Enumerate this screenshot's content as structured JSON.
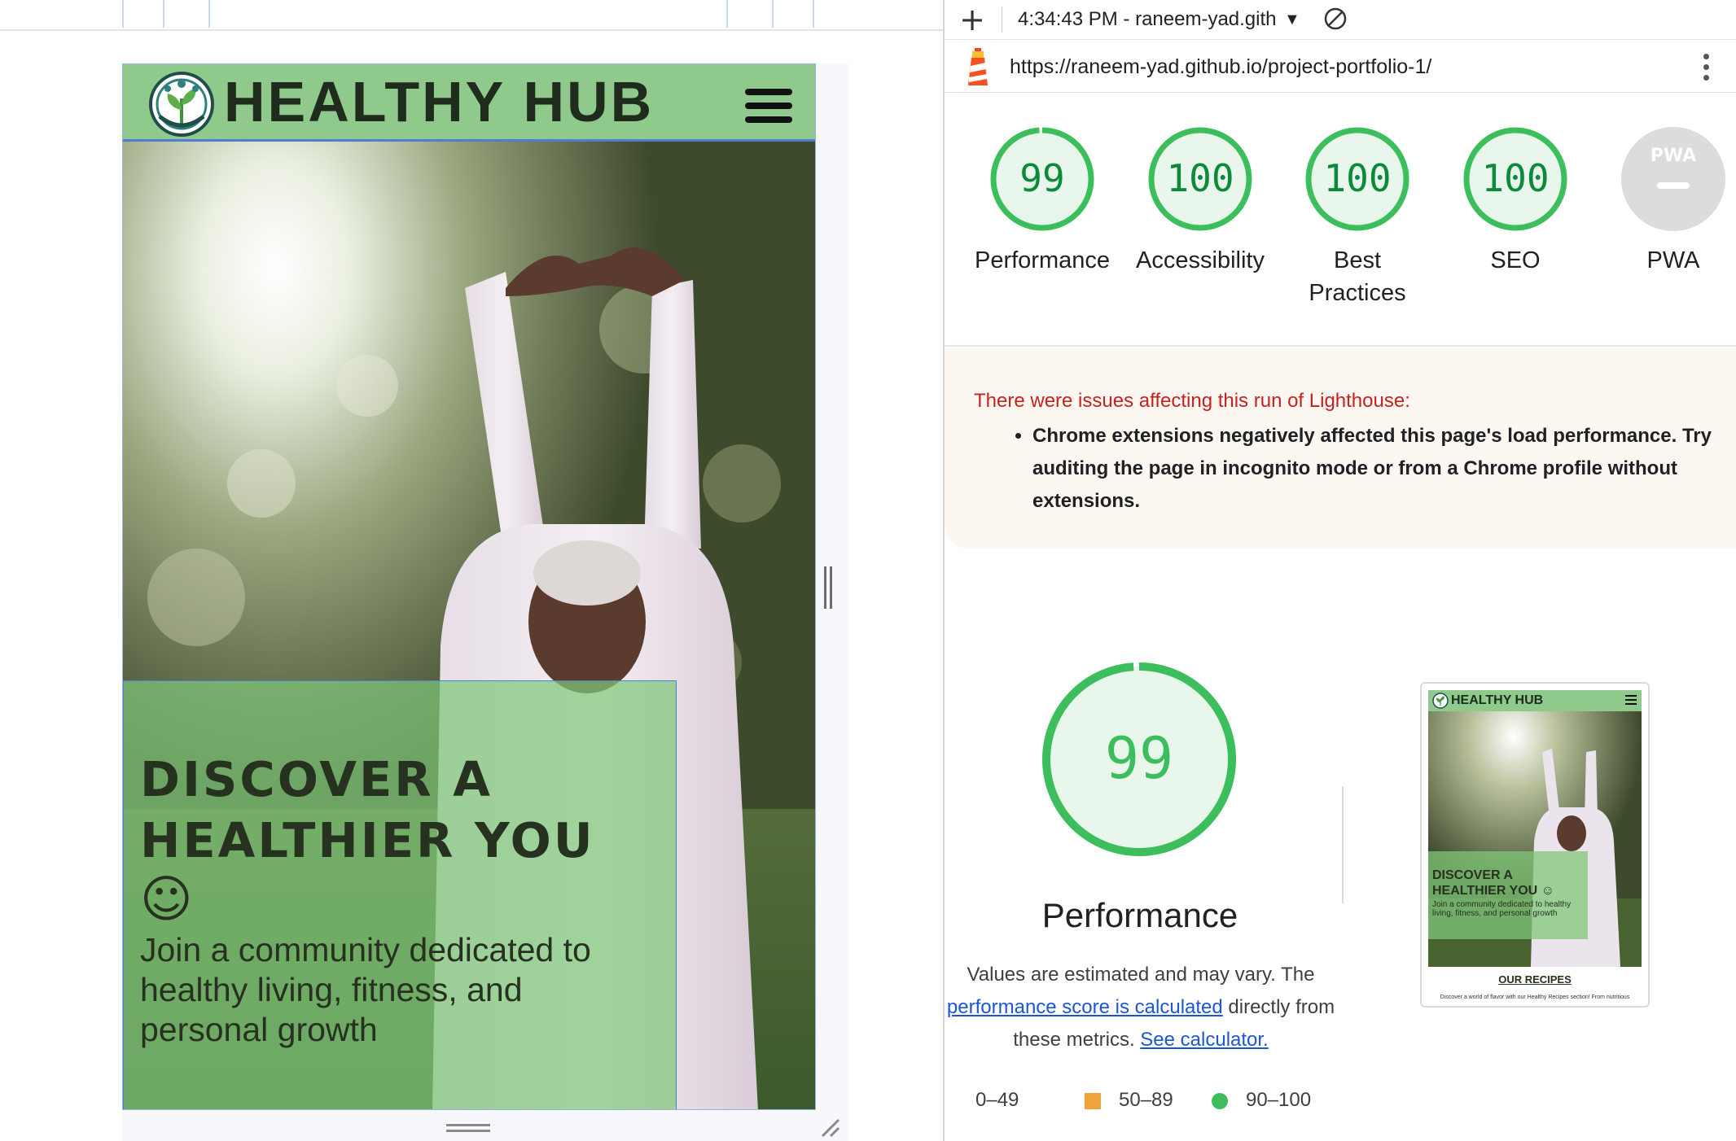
{
  "preview": {
    "site": {
      "title": "HEALTHY HUB",
      "hero_heading": "DISCOVER A HEALTHIER YOU",
      "hero_smiley": "☺",
      "hero_text": "Join a community dedicated to healthy living, fitness, and personal growth",
      "header_color": "#8fc98c",
      "hero_box_color": "#80c87a"
    }
  },
  "panel": {
    "toolbar": {
      "new_report_icon": "plus-icon",
      "report_label": "4:34:43 PM - raneem-yad.gith",
      "clear_icon": "block-icon"
    },
    "url": "https://raneem-yad.github.io/project-portfolio-1/",
    "categories": [
      {
        "label": "Performance",
        "score": "99",
        "percent": 99
      },
      {
        "label": "Accessibility",
        "score": "100",
        "percent": 100
      },
      {
        "label": "Best Practices",
        "score": "100",
        "percent": 100
      },
      {
        "label": "SEO",
        "score": "100",
        "percent": 100
      },
      {
        "label": "PWA",
        "badge": "PWA"
      }
    ],
    "warning": {
      "title": "There were issues affecting this run of Lighthouse:",
      "items": [
        "Chrome extensions negatively affected this page's load performance. Try auditing the page in incognito mode or from a Chrome profile without extensions."
      ]
    },
    "performance": {
      "score": "99",
      "percent": 99,
      "label": "Performance",
      "note_start": "Values are estimated and may vary. The ",
      "note_link1": "performance score is calculated",
      "note_middle": " directly from these metrics. ",
      "note_link2": "See calculator."
    },
    "legend": [
      {
        "range": "0–49",
        "shape": "triangle",
        "color": "#e03a2f"
      },
      {
        "range": "50–89",
        "shape": "square",
        "color": "#f0a33a"
      },
      {
        "range": "90–100",
        "shape": "circle",
        "color": "#3dbe5c"
      }
    ],
    "thumbnail": {
      "title": "HEALTHY HUB",
      "heading": "DISCOVER A HEALTHIER YOU ☺",
      "text": "Join a community dedicated to healthy living, fitness, and personal growth",
      "recipes": "OUR RECIPES",
      "recipes_text": "Discover a world of flavor with our Healthy Recipes section! From nutritious"
    },
    "colors": {
      "pass": "#0c8a3c",
      "pass_ring": "#3dbe5c",
      "pass_fill": "#e8f6ec",
      "warning_text": "#c5221f",
      "link": "#1a56d6"
    }
  }
}
